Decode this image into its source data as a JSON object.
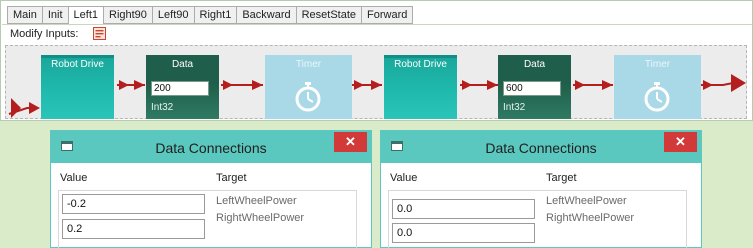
{
  "tabs": [
    "Main",
    "Init",
    "Left1",
    "Right90",
    "Left90",
    "Right1",
    "Backward",
    "ResetState",
    "Forward"
  ],
  "active_tab": "Left1",
  "toolbar": {
    "modify_inputs_label": "Modify Inputs:"
  },
  "blocks": [
    {
      "type": "robot",
      "title": "Robot Drive"
    },
    {
      "type": "data",
      "title": "Data",
      "value": "200",
      "datatype": "Int32"
    },
    {
      "type": "timer",
      "title": "Timer"
    },
    {
      "type": "robot",
      "title": "Robot Drive"
    },
    {
      "type": "data",
      "title": "Data",
      "value": "600",
      "datatype": "Int32"
    },
    {
      "type": "timer",
      "title": "Timer"
    }
  ],
  "dialogs": [
    {
      "title": "Data Connections",
      "close_label": "✕",
      "col_value": "Value",
      "col_target": "Target",
      "rows": [
        {
          "value": "-0.2",
          "target": "LeftWheelPower"
        },
        {
          "value": "0.2",
          "target": "RightWheelPower"
        }
      ]
    },
    {
      "title": "Data Connections",
      "close_label": "✕",
      "col_value": "Value",
      "col_target": "Target",
      "rows": [
        {
          "value": "0.0",
          "target": "LeftWheelPower"
        },
        {
          "value": "0.0",
          "target": "RightWheelPower"
        }
      ]
    }
  ],
  "colors": {
    "background": "#d9ebc9",
    "robot_block": "#1fb9ad",
    "data_block": "#1f5e4a",
    "timer_block": "#a9d8e6",
    "arrow": "#b41e1e",
    "dialog_titlebar": "#5bc8c0",
    "close_button": "#d23a3a"
  },
  "icons": {
    "modify_inputs": "edit-list-icon",
    "timer": "stopwatch-icon",
    "dialog": "window-icon"
  }
}
